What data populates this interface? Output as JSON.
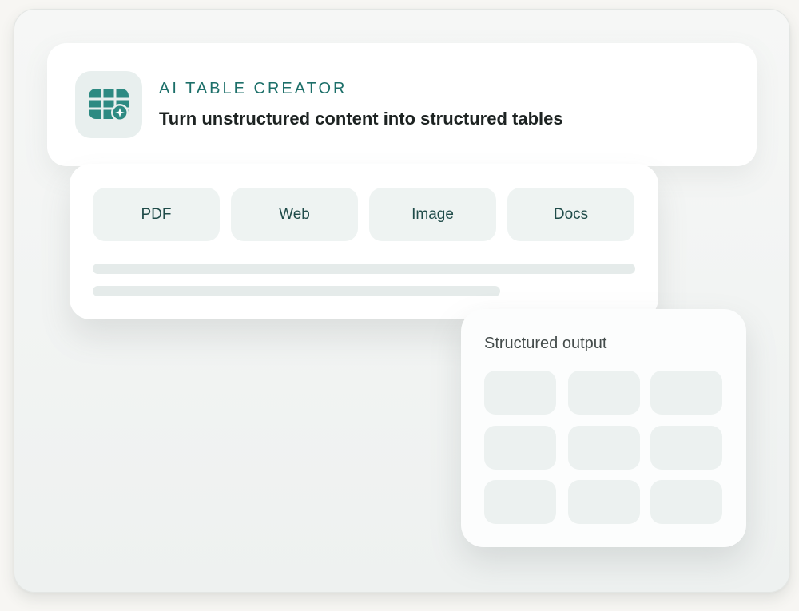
{
  "header": {
    "kicker": "AI TABLE CREATOR",
    "title": "Turn unstructured content into structured tables",
    "icon": "table-sparkle-icon",
    "accent_color": "#1c6f69"
  },
  "sources": {
    "items": [
      {
        "label": "PDF"
      },
      {
        "label": "Web"
      },
      {
        "label": "Image"
      },
      {
        "label": "Docs"
      }
    ]
  },
  "output": {
    "title": "Structured output",
    "rows": 3,
    "columns": 3
  }
}
